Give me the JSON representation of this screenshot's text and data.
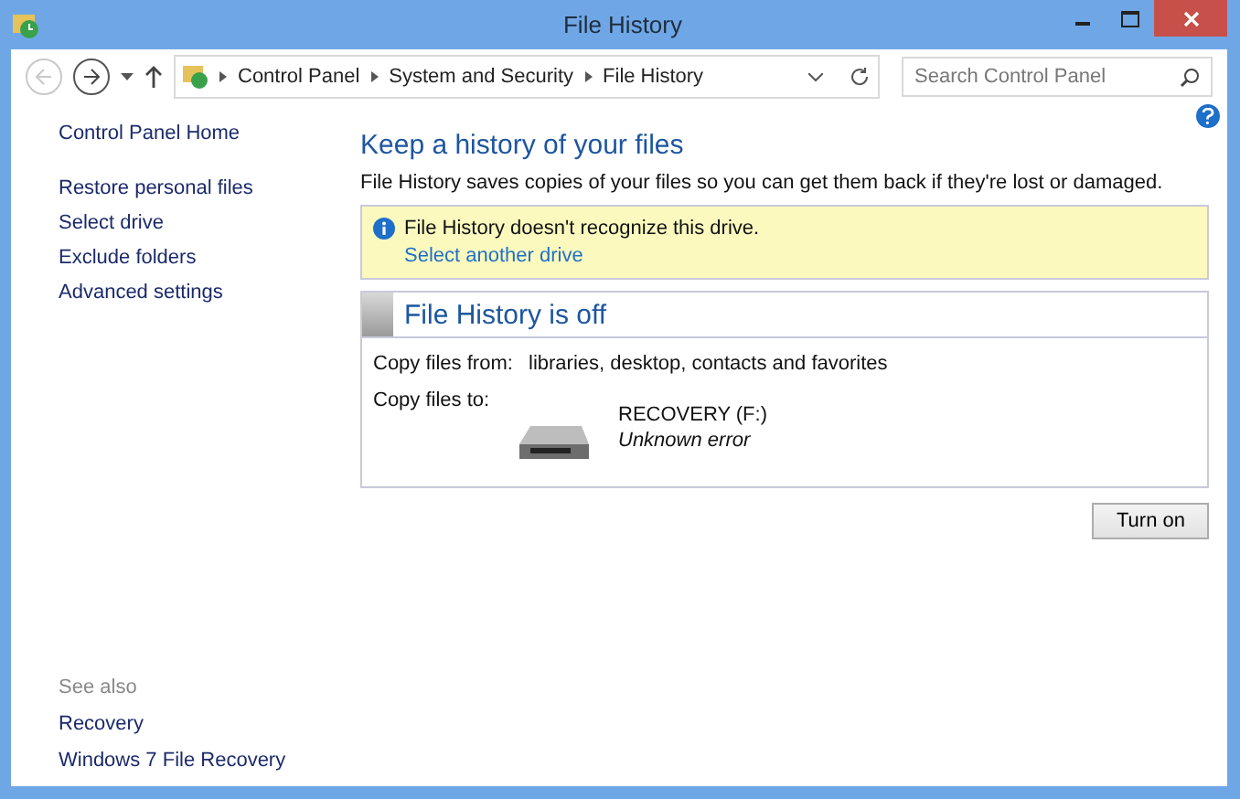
{
  "window": {
    "title": "File History"
  },
  "nav": {
    "back_disabled": true,
    "breadcrumb": [
      "Control Panel",
      "System and Security",
      "File History"
    ],
    "search": {
      "placeholder": "Search Control Panel"
    }
  },
  "sidebar": {
    "links": [
      {
        "label": "Control Panel Home",
        "kind": "home"
      },
      {
        "label": "Restore personal files",
        "kind": "task"
      },
      {
        "label": "Select drive",
        "kind": "task"
      },
      {
        "label": "Exclude folders",
        "kind": "task"
      },
      {
        "label": "Advanced settings",
        "kind": "task"
      }
    ],
    "see_also": {
      "title": "See also",
      "links": [
        "Recovery",
        "Windows 7 File Recovery"
      ]
    }
  },
  "main": {
    "heading": "Keep a history of your files",
    "description": "File History saves copies of your files so you can get them back if they're lost or damaged.",
    "notice": {
      "message": "File History doesn't recognize this drive.",
      "link": "Select another drive"
    },
    "status": {
      "title": "File History is off",
      "copy_from_label": "Copy files from:",
      "copy_from": "libraries, desktop, contacts and favorites",
      "copy_to_label": "Copy files to:",
      "drive_name": "RECOVERY (F:)",
      "drive_status": "Unknown error"
    },
    "button": "Turn on"
  }
}
